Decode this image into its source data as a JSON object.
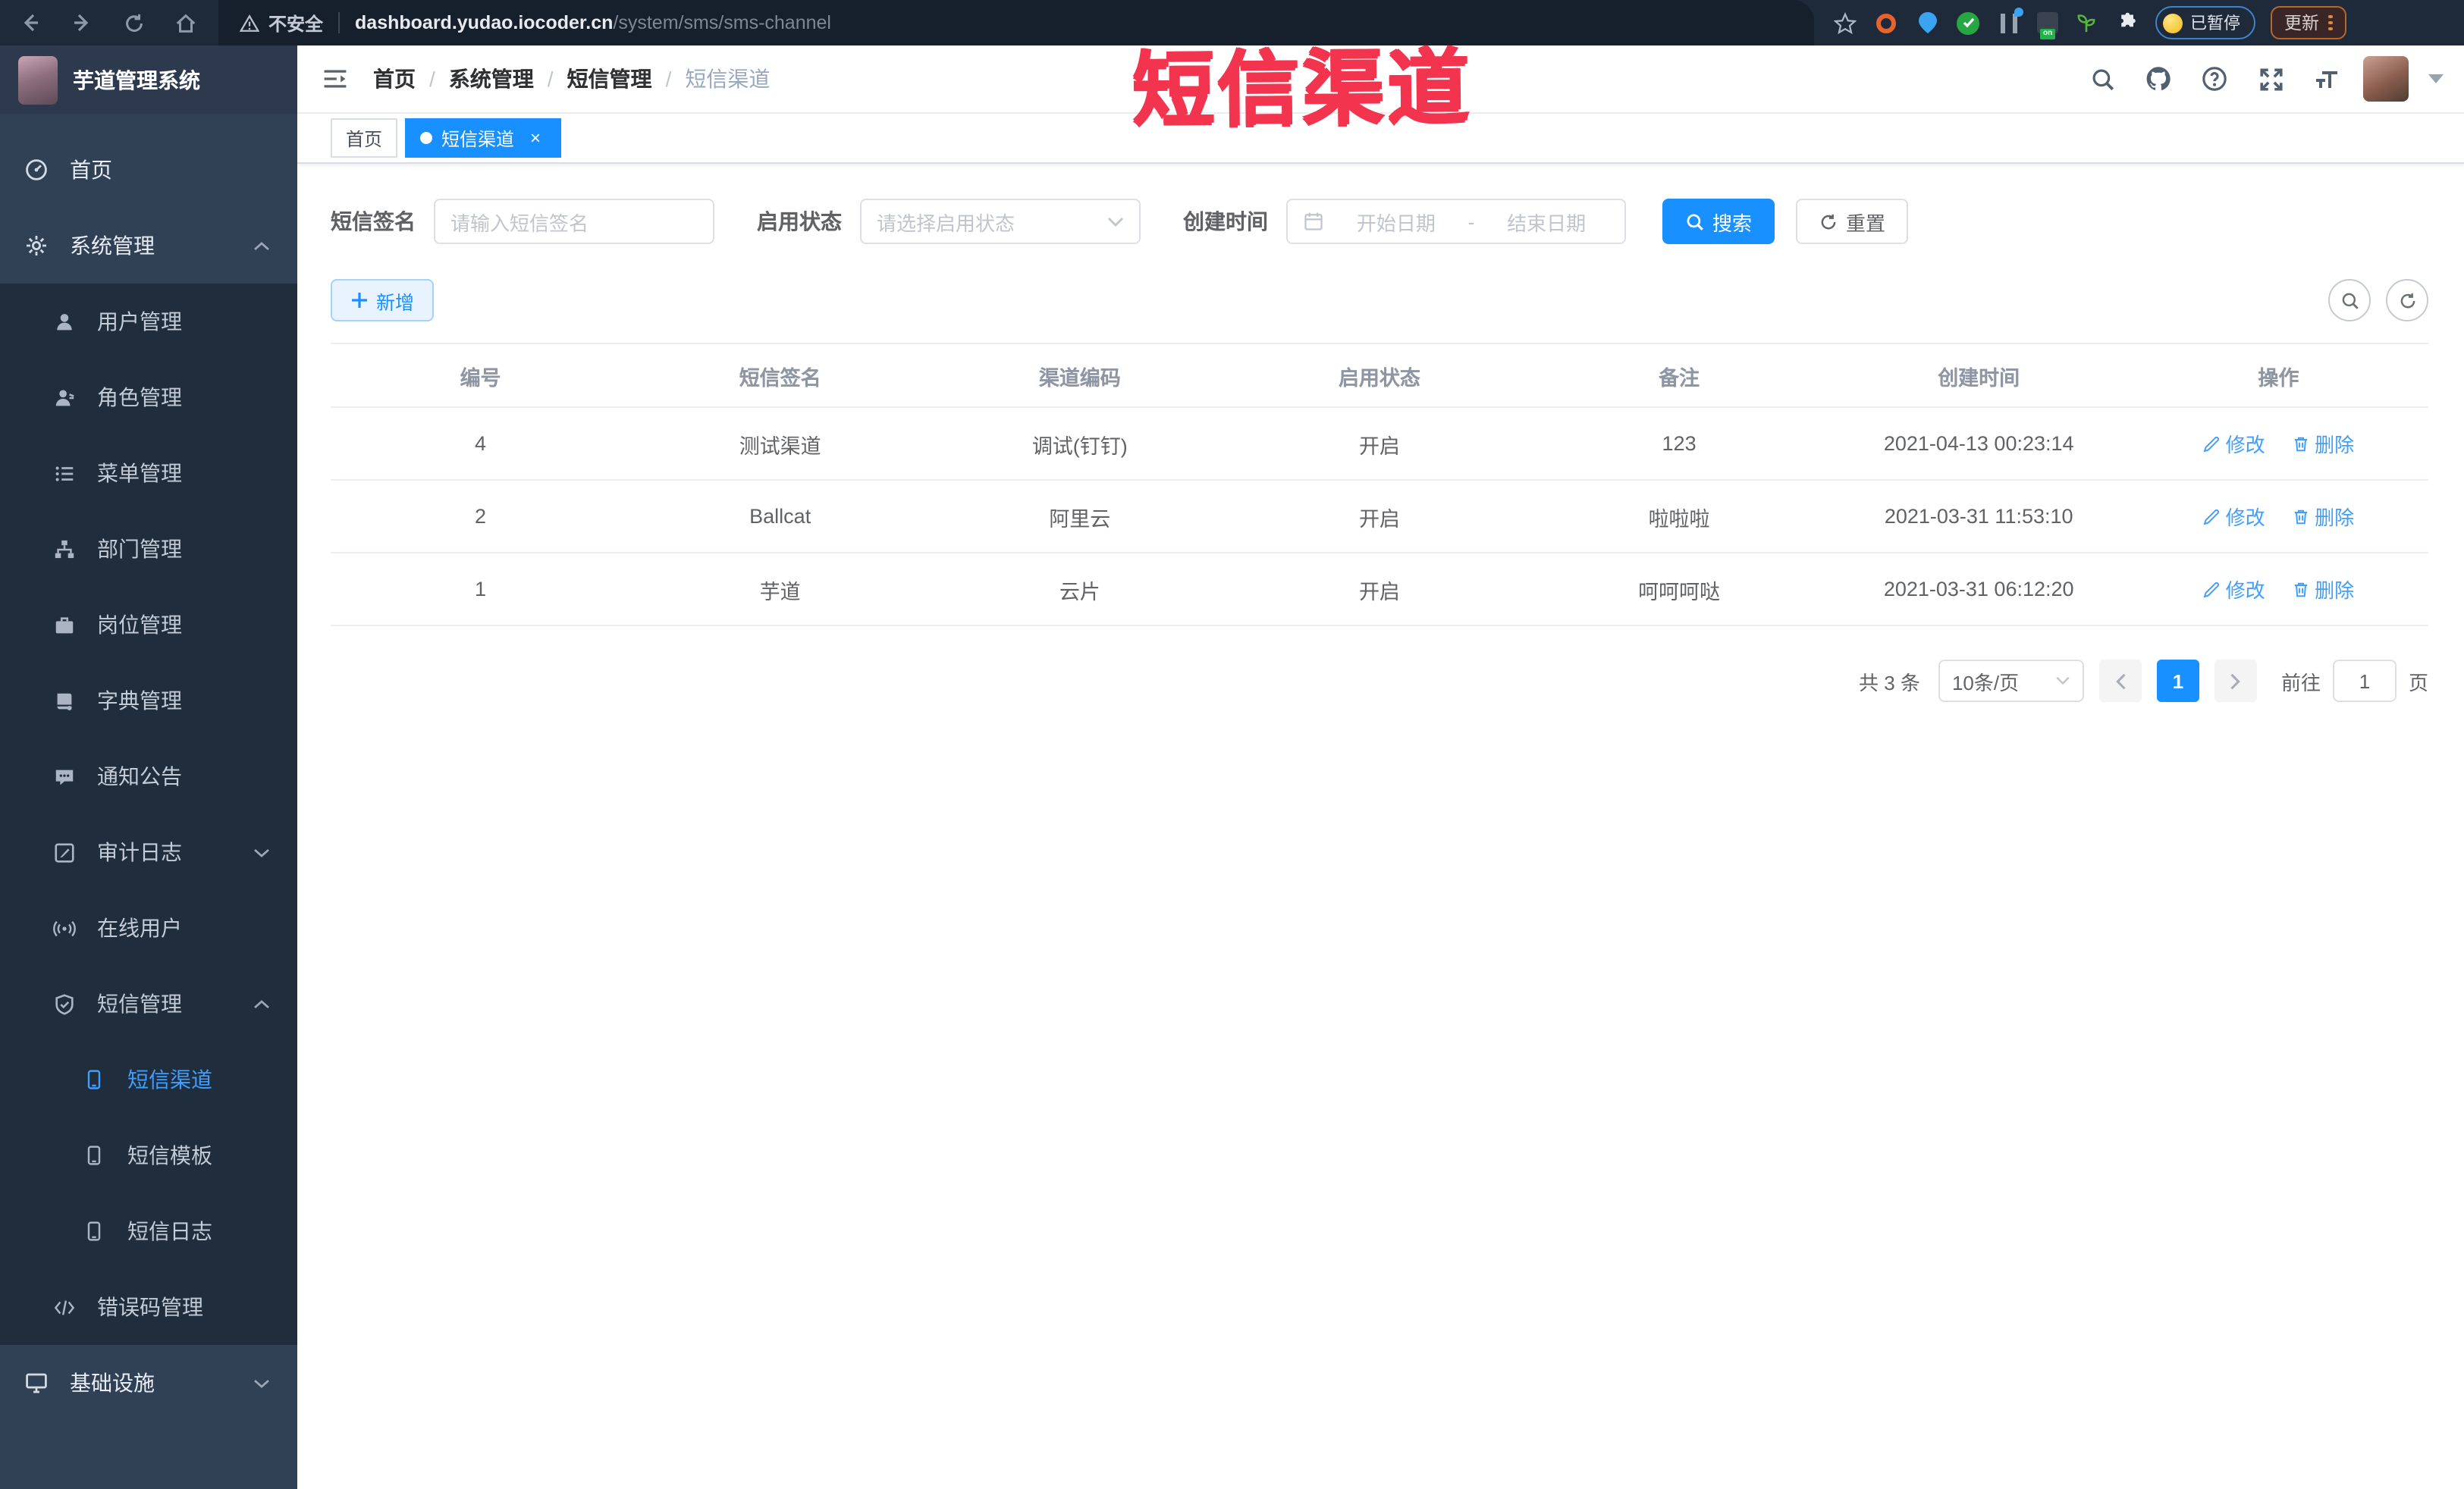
{
  "browser": {
    "security_label": "不安全",
    "url_domain": "dashboard.yudao.iocoder.cn",
    "url_path": "/system/sms/sms-channel",
    "paused_label": "已暂停",
    "update_label": "更新"
  },
  "annotation": {
    "text": "短信渠道",
    "color": "#f2344e"
  },
  "app": {
    "logo_title": "芋道管理系统"
  },
  "breadcrumb": {
    "separator": "/",
    "items": [
      "首页",
      "系统管理",
      "短信管理",
      "短信渠道"
    ]
  },
  "tabs": {
    "home_label": "首页",
    "active_label": "短信渠道",
    "close_glyph": "×"
  },
  "sidebar": {
    "items": [
      {
        "label": "首页"
      },
      {
        "label": "系统管理"
      },
      {
        "label": "用户管理"
      },
      {
        "label": "角色管理"
      },
      {
        "label": "菜单管理"
      },
      {
        "label": "部门管理"
      },
      {
        "label": "岗位管理"
      },
      {
        "label": "字典管理"
      },
      {
        "label": "通知公告"
      },
      {
        "label": "审计日志"
      },
      {
        "label": "在线用户"
      },
      {
        "label": "短信管理"
      },
      {
        "label": "短信渠道",
        "active": true
      },
      {
        "label": "短信模板"
      },
      {
        "label": "短信日志"
      },
      {
        "label": "错误码管理"
      },
      {
        "label": "基础设施"
      }
    ]
  },
  "filters": {
    "sign_label": "短信签名",
    "sign_placeholder": "请输入短信签名",
    "status_label": "启用状态",
    "status_placeholder": "请选择启用状态",
    "time_label": "创建时间",
    "start_placeholder": "开始日期",
    "range_separator": "-",
    "end_placeholder": "结束日期",
    "search_label": "搜索",
    "reset_label": "重置"
  },
  "toolbar": {
    "add_label": "新增"
  },
  "table": {
    "headers": [
      "编号",
      "短信签名",
      "渠道编码",
      "启用状态",
      "备注",
      "创建时间",
      "操作"
    ],
    "edit_label": "修改",
    "delete_label": "删除",
    "rows": [
      {
        "id": "4",
        "sign": "测试渠道",
        "code": "调试(钉钉)",
        "status": "开启",
        "remark": "123",
        "created": "2021-04-13 00:23:14"
      },
      {
        "id": "2",
        "sign": "Ballcat",
        "code": "阿里云",
        "status": "开启",
        "remark": "啦啦啦",
        "created": "2021-03-31 11:53:10"
      },
      {
        "id": "1",
        "sign": "芋道",
        "code": "云片",
        "status": "开启",
        "remark": "呵呵呵哒",
        "created": "2021-03-31 06:12:20"
      }
    ]
  },
  "pagination": {
    "total_text": "共 3 条",
    "page_size": "10条/页",
    "current_page": "1",
    "goto_label": "前往",
    "goto_value": "1",
    "page_unit": "页"
  },
  "icons": {
    "back-icon": "←",
    "forward-icon": "→",
    "refresh-icon": "↻",
    "home-icon": "⌂",
    "warning-icon": "⚠",
    "star-icon": "☆",
    "puzzle-icon": "puzzle",
    "search-icon": "magnifier",
    "github-icon": "octocat",
    "help-icon": "?",
    "fullscreen-icon": "expand",
    "font-size-icon": "T",
    "caret-down-icon": "v",
    "calendar-icon": "calendar",
    "plus-icon": "+",
    "edit-icon": "pencil",
    "delete-icon": "trash"
  }
}
